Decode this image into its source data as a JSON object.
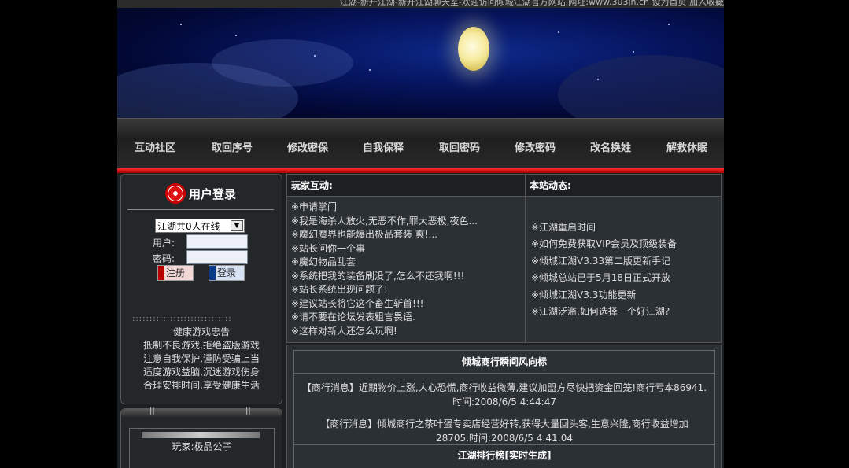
{
  "marquee": "江湖-新开江湖-新开江湖聊天室-欢迎访问倾城江湖官方网站,网址:www.303jh.cn 设为首页 加入收藏",
  "nav": [
    "互动社区",
    "取回序号",
    "修改密保",
    "自我保释",
    "取回密码",
    "修改密码",
    "改名换姓",
    "解救休眠"
  ],
  "login": {
    "title": "用户登录",
    "online_select": "江湖共0人在线",
    "user_label": "用户:",
    "pass_label": "密码:",
    "register": "注册",
    "login": "登录",
    "dots": ":::::::::::::::::::::::::::::",
    "notice": [
      "健康游戏忠告",
      "抵制不良游戏,拒绝盗版游戏",
      "注意自我保护,谨防受骗上当",
      "适度游戏益脑,沉迷游戏伤身",
      "合理安排时间,享受健康生活"
    ]
  },
  "player": {
    "name": "玩家:极品公子"
  },
  "interaction": {
    "title": "玩家互动:",
    "items": [
      "※申请掌门",
      "※我是海杀人放火,无恶不作,罪大恶极,夜色...",
      "※魔幻魔界也能爆出极品套装 爽!...",
      "※站长问你一个事",
      "※魔幻物品乱套",
      "※系统把我的装备刷没了,怎么不还我啊!!!",
      "※站长系统出现问题了!",
      "※建议站长将它这个畜生斩首!!!",
      "※请不要在论坛发表粗言畏语.",
      "※这样对新人还怎么玩啊!"
    ]
  },
  "news": {
    "title": "本站动态:",
    "items": [
      "※江湖重启时间",
      "※如何免费获取VIP会员及顶级装备",
      "※倾城江湖V3.33第二版更新手记",
      "※倾城总站已于5月18日正式开放",
      "※倾城江湖V3.3功能更新",
      "※江湖泛滥,如何选择一个好江湖?"
    ]
  },
  "trade": {
    "title": "倾城商行瞬间风向标",
    "msgs": [
      [
        "【商行消息】近期物价上涨,人心恐慌,商行收益微薄,建议加盟方尽快把资金回笼!商行亏本86941.",
        "时间:2008/6/5 4:44:47"
      ],
      [
        "【商行消息】倾城商行之茶叶蛋专卖店经营好转,获得大量回头客,生意兴隆,商行收益增加",
        "28705.时间:2008/6/5 4:41:04"
      ]
    ]
  },
  "ranking": {
    "title": "江湖排行榜[实时生成]"
  }
}
